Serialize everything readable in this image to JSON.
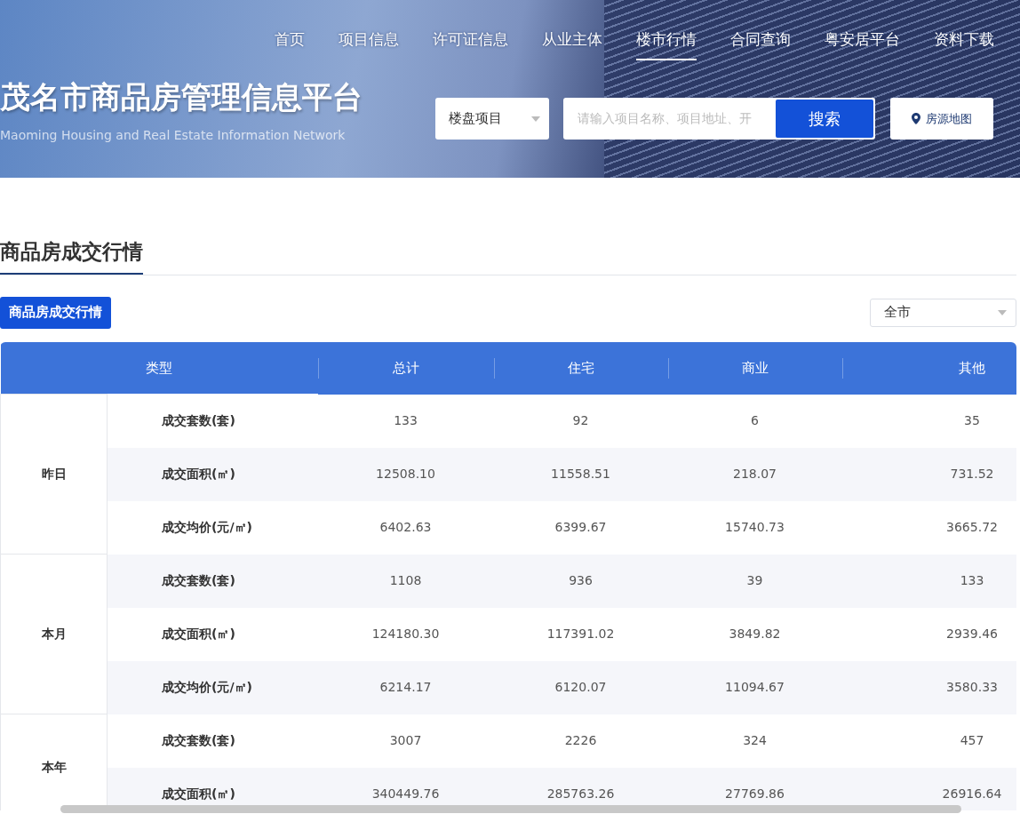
{
  "header": {
    "nav": [
      {
        "label": "首页",
        "selected": false
      },
      {
        "label": "项目信息",
        "selected": false
      },
      {
        "label": "许可证信息",
        "selected": false
      },
      {
        "label": "从业主体",
        "selected": false
      },
      {
        "label": "楼市行情",
        "selected": true
      },
      {
        "label": "合同查询",
        "selected": false
      },
      {
        "label": "粤安居平台",
        "selected": false
      },
      {
        "label": "资料下载",
        "selected": false
      }
    ],
    "site_title": "茂名市商品房管理信息平台",
    "site_subtitle": "Maoming Housing and Real Estate Information Network",
    "search": {
      "category": "楼盘项目",
      "placeholder": "请输入项目名称、项目地址、开",
      "button": "搜索"
    },
    "map_button": "房源地图"
  },
  "section": {
    "title": "商品房成交行情",
    "tabs": [
      {
        "label": "商品房成交行情",
        "selected": true
      }
    ],
    "region_select": "全市"
  },
  "table": {
    "columns": [
      "类型",
      "总计",
      "住宅",
      "商业",
      "其他"
    ],
    "groups": [
      {
        "label": "昨日",
        "rows": [
          {
            "type": "成交套数(套)",
            "values": [
              "133",
              "92",
              "6",
              "35"
            ]
          },
          {
            "type": "成交面积(㎡)",
            "values": [
              "12508.10",
              "11558.51",
              "218.07",
              "731.52"
            ]
          },
          {
            "type": "成交均价(元/㎡)",
            "values": [
              "6402.63",
              "6399.67",
              "15740.73",
              "3665.72"
            ]
          }
        ]
      },
      {
        "label": "本月",
        "rows": [
          {
            "type": "成交套数(套)",
            "values": [
              "1108",
              "936",
              "39",
              "133"
            ]
          },
          {
            "type": "成交面积(㎡)",
            "values": [
              "124180.30",
              "117391.02",
              "3849.82",
              "2939.46"
            ]
          },
          {
            "type": "成交均价(元/㎡)",
            "values": [
              "6214.17",
              "6120.07",
              "11094.67",
              "3580.33"
            ]
          }
        ]
      },
      {
        "label": "本年",
        "rows": [
          {
            "type": "成交套数(套)",
            "values": [
              "3007",
              "2226",
              "324",
              "457"
            ]
          },
          {
            "type": "成交面积(㎡)",
            "values": [
              "340449.76",
              "285763.26",
              "27769.86",
              "26916.64"
            ]
          }
        ]
      }
    ]
  }
}
